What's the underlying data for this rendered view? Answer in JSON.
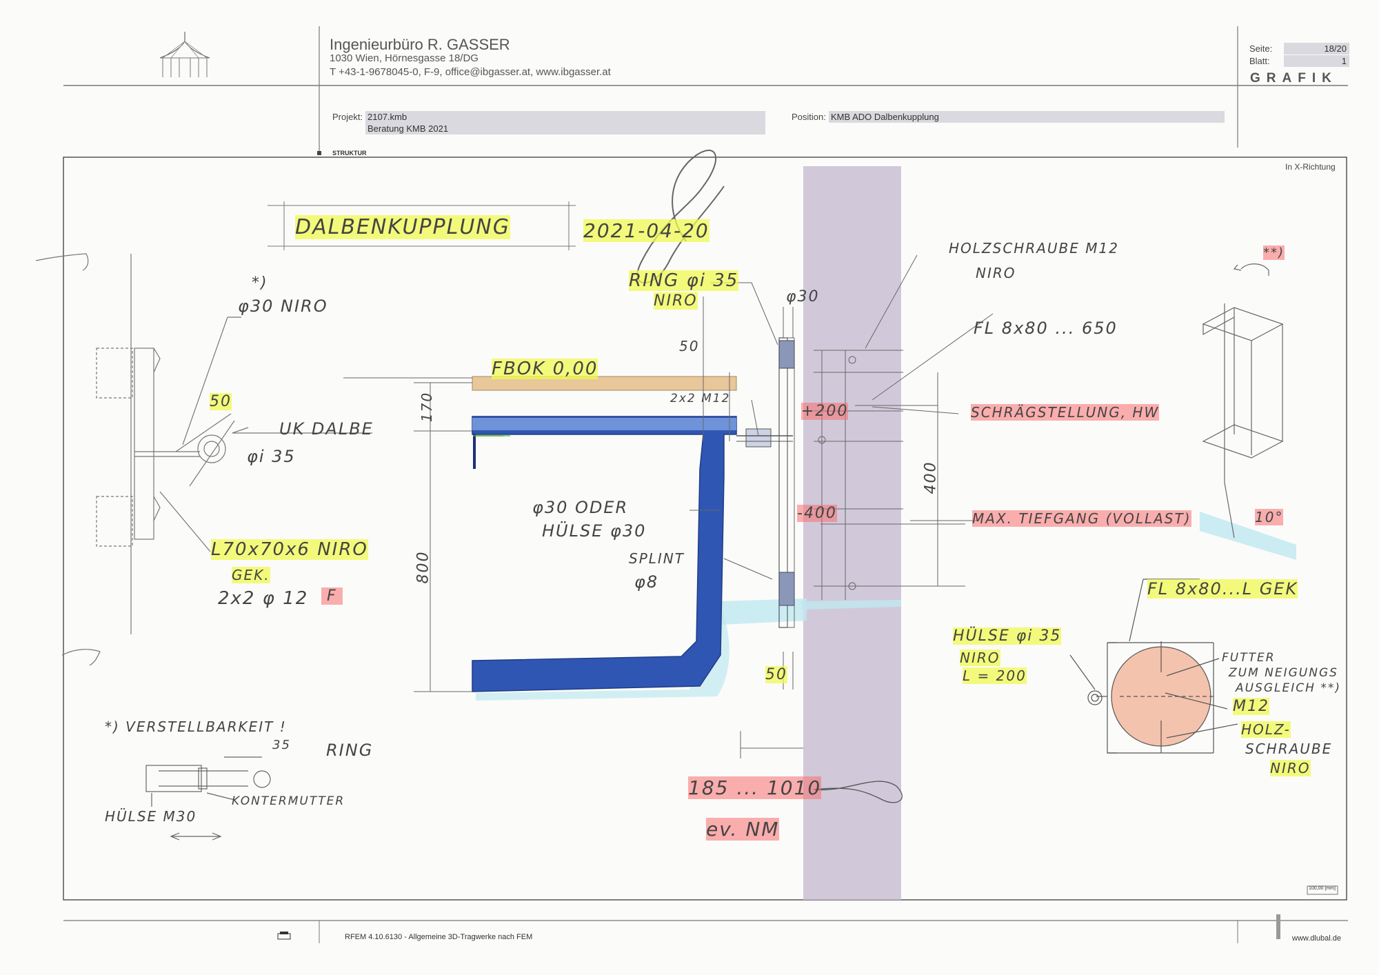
{
  "header": {
    "firm": "Ingenieurbüro R. GASSER",
    "address": "1030 Wien, Hörnesgasse 18/DG",
    "contact": "T +43-1-9678045-0,  F-9,  office@ibgasser.at,  www.ibgasser.at",
    "seite_label": "Seite:",
    "seite_value": "18/20",
    "blatt_label": "Blatt:",
    "blatt_value": "1",
    "grafik": "GRAFIK"
  },
  "project": {
    "projekt_label": "Projekt:",
    "projekt_value": "2107.kmb",
    "projekt_sub": "Beratung KMB 2021",
    "position_label": "Position:",
    "position_value": "KMB ADO Dalbenkupplung",
    "struktur": "STRUKTUR"
  },
  "drawing": {
    "direction": "In X-Richtung",
    "scale": "100,00 [mm]",
    "title": "DALBENKUPPLUNG",
    "date": "2021-04-20",
    "notes": {
      "star_note": "*)",
      "phi30": "φ30 NIRO",
      "dim50_left": "50",
      "uk_dalbe": "UK DALBE",
      "phi_i35": "φi 35",
      "angle": "L70x70x6 NIRO",
      "gek": "GEK.",
      "bolts_left": "2x2 φ 12",
      "f_mark": "F",
      "ring_phi": "RING φi 35",
      "niro_ring": "NIRO",
      "dim50_top": "50",
      "phi30_top": "φ30",
      "fbok": "FBOK 0,00",
      "dim170": "170",
      "bolts_m12": "2x2 M12",
      "plus200": "+200",
      "minus400": "-400",
      "phi30_oder": "φ30 ODER",
      "huelse_phi30": "HÜLSE φ30",
      "splint": "SPLINT",
      "phi8": "φ8",
      "dim800": "800",
      "dim400": "400",
      "dim50_bottom": "50",
      "range": "185 ... 1010",
      "evtl": "ev. NM",
      "holzschraube": "HOLZSCHRAUBE M12",
      "niro_holz": "NIRO",
      "fl": "FL 8x80 ... 650",
      "schraeg": "SCHRÄGSTELLUNG, HW",
      "tiefgang": "MAX. TIEFGANG (VOLLAST)",
      "deg10": "10°",
      "xx_top": "**)",
      "fl_gek": "FL 8x80...L GEK",
      "huelse_phi35": "HÜLSE φi 35",
      "niro_huelse": "NIRO",
      "l200": "L = 200",
      "futter": "FUTTER",
      "neigung": "ZUM NEIGUNGS",
      "ausgleich": "AUSGLEICH **)",
      "m12": "M12",
      "holz": "HOLZ-",
      "schraube": "SCHRAUBE",
      "niro_schraube": "NIRO",
      "verstell": "*) VERSTELLBARKEIT !",
      "dim35": "35",
      "ring": "RING",
      "kontermutter": "KONTERMUTTER",
      "huelse_m30": "HÜLSE M30"
    }
  },
  "footer": {
    "software": "RFEM 4.10.6130 - Allgemeine 3D-Tragwerke nach FEM",
    "website": "www.dlubal.de"
  }
}
